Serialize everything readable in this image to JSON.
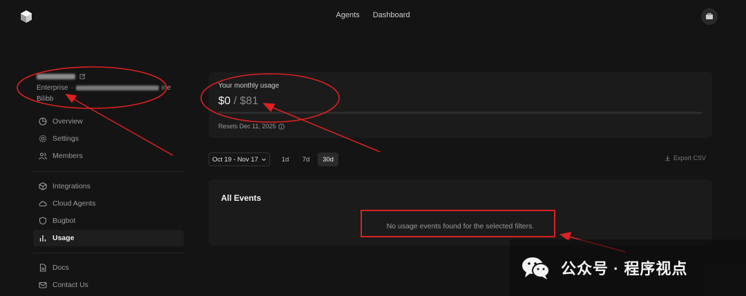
{
  "topbar": {
    "nav": [
      "Agents",
      "Dashboard"
    ],
    "logo_icon": "cube-logo-icon",
    "avatar_icon": "avatar-icon"
  },
  "account": {
    "plan_prefix": "Enterprise",
    "plan_suffix": "ine",
    "line2": "Bilibb"
  },
  "sidebar": {
    "group1": [
      {
        "label": "Overview",
        "icon": "pie-chart-icon"
      },
      {
        "label": "Settings",
        "icon": "gear-icon"
      },
      {
        "label": "Members",
        "icon": "users-icon"
      }
    ],
    "group2": [
      {
        "label": "Integrations",
        "icon": "box-icon"
      },
      {
        "label": "Cloud Agents",
        "icon": "cloud-icon"
      },
      {
        "label": "Bugbot",
        "icon": "shield-icon"
      },
      {
        "label": "Usage",
        "icon": "bar-chart-icon",
        "active": true
      }
    ],
    "group3": [
      {
        "label": "Docs",
        "icon": "document-icon"
      },
      {
        "label": "Contact Us",
        "icon": "mail-icon"
      }
    ]
  },
  "usage": {
    "title": "Your monthly usage",
    "spent": "$0",
    "separator": "/",
    "limit": "$81",
    "progress_fraction": 0,
    "reset": "Resets Dec 11, 2025"
  },
  "filters": {
    "date_range": "Oct 19 - Nov 17",
    "ranges": [
      "1d",
      "7d",
      "30d"
    ],
    "active_range": "30d",
    "export": "Export CSV"
  },
  "events": {
    "title": "All Events",
    "empty": "No usage events found for the selected filters."
  },
  "watermark": {
    "text": "公众号 · 程序视点"
  },
  "colors": {
    "background": "#141414",
    "card": "#1b1b1b",
    "annotation_red": "#e02020"
  }
}
